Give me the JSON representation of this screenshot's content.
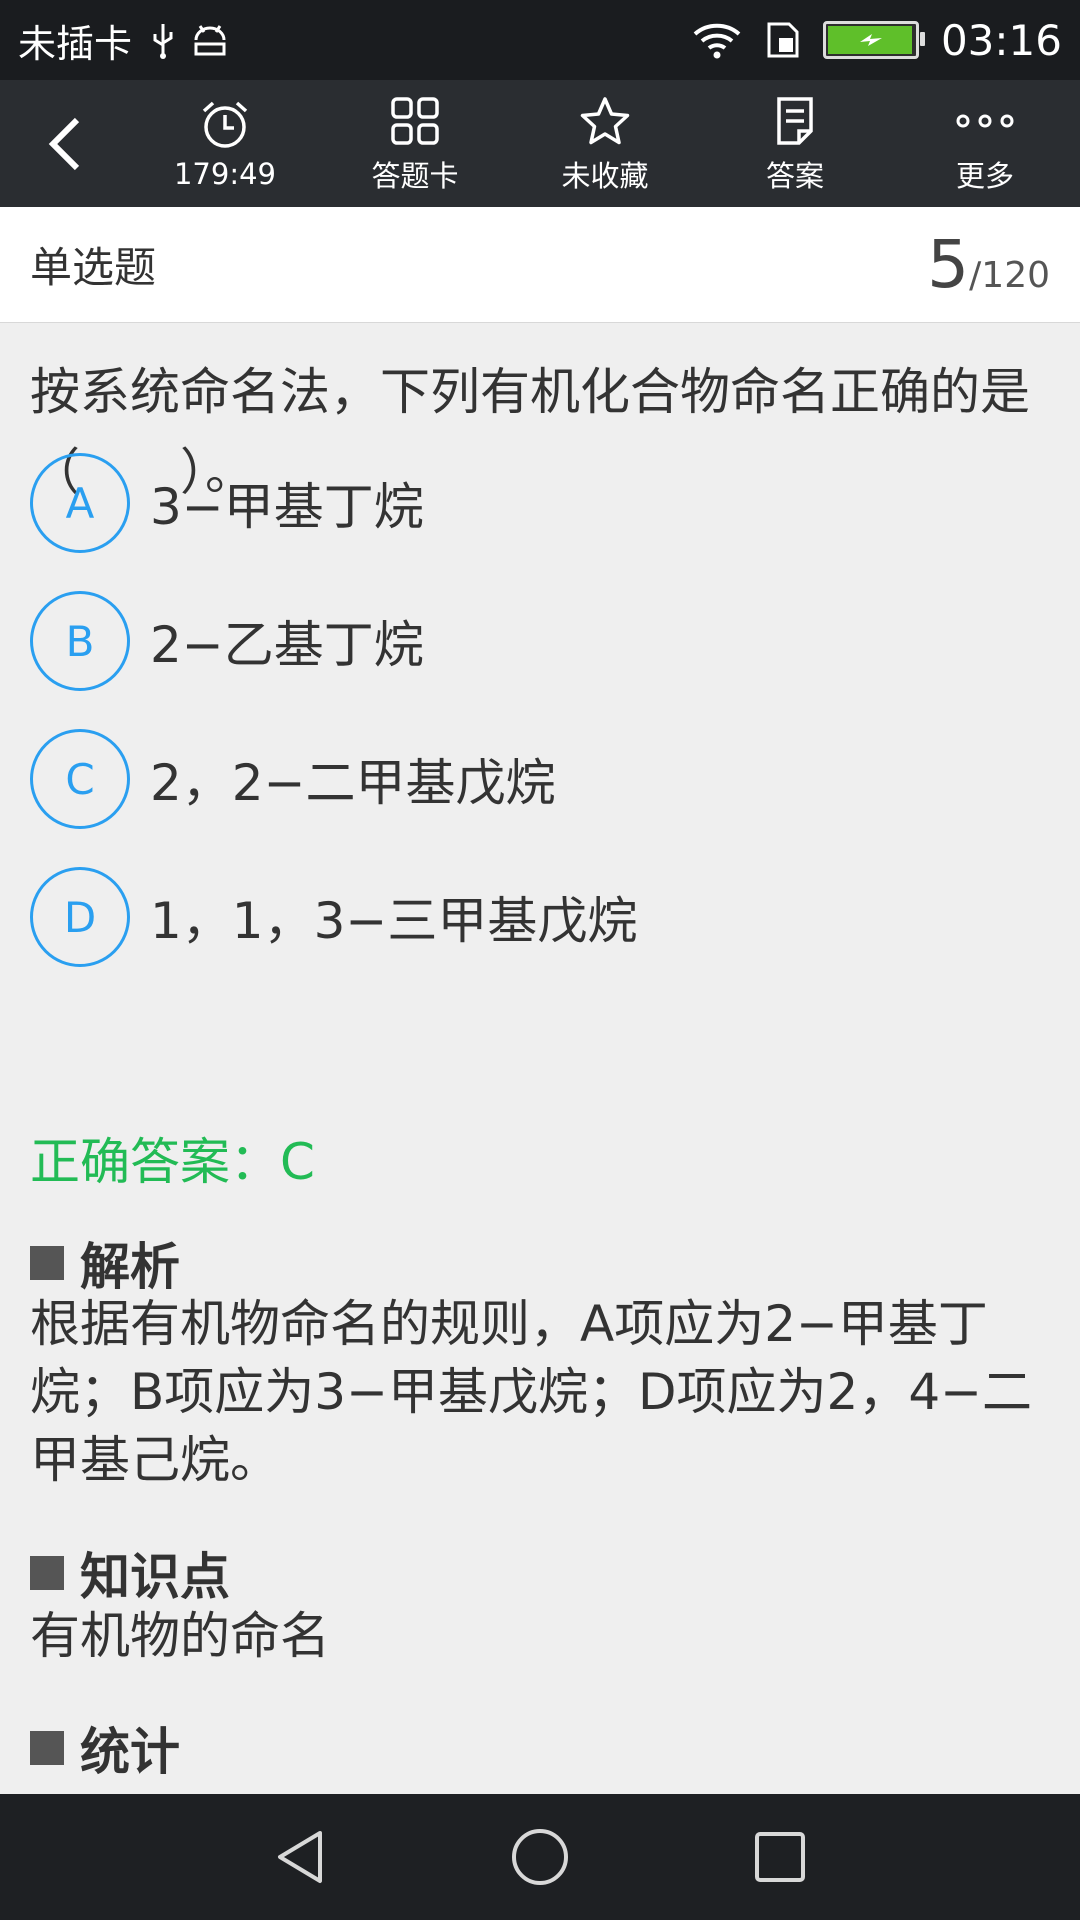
{
  "status_bar": {
    "carrier": "未插卡",
    "time": "03:16",
    "icons": [
      "usb-icon",
      "android-debug-icon",
      "wifi-icon",
      "sim-icon",
      "battery-charging-icon"
    ]
  },
  "toolbar": {
    "timer": "179:49",
    "answer_card": "答题卡",
    "favorite": "未收藏",
    "answer": "答案",
    "more": "更多"
  },
  "header": {
    "type": "单选题",
    "current": "5",
    "total": "/120"
  },
  "question": {
    "text": "按系统命名法，下列有机化合物命名正确的是（　　）。",
    "options": [
      {
        "letter": "A",
        "text": "3−甲基丁烷"
      },
      {
        "letter": "B",
        "text": "2−乙基丁烷"
      },
      {
        "letter": "C",
        "text": "2，2−二甲基戊烷"
      },
      {
        "letter": "D",
        "text": "1，1，3−三甲基戊烷"
      }
    ]
  },
  "answer": {
    "label": "正确答案：C"
  },
  "analysis": {
    "title": "解析",
    "body": "根据有机物命名的规则，A项应为2−甲基丁烷；B项应为3−甲基戊烷；D项应为2，4−二甲基己烷。"
  },
  "knowledge": {
    "title": "知识点",
    "body": "有机物的命名"
  },
  "stats": {
    "title": "统计"
  },
  "colors": {
    "accent": "#2a9ff0",
    "correct": "#22bb55",
    "toolbar_bg": "#2a2d31"
  }
}
